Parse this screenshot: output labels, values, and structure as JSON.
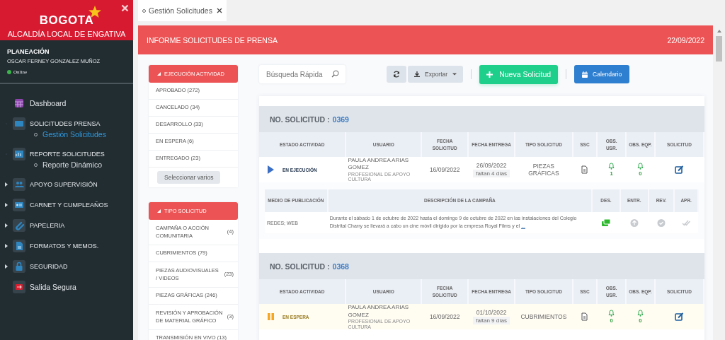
{
  "sidebar": {
    "logo": "BOGOTA",
    "subtitle": "ALCALDÍA LOCAL DE ENGATIVA",
    "user": {
      "role": "PLANEACIÓN",
      "name": "OSCAR FERNEY GONZALEZ MUÑOZ",
      "status": "Online"
    },
    "menu": [
      {
        "kind": "link",
        "label": "Dashboard"
      },
      {
        "kind": "group",
        "label": "SOLICITUDES PRENSA",
        "expanded": true,
        "children": [
          {
            "label": "Gestión Solicitudes",
            "selected": true
          }
        ]
      },
      {
        "kind": "group",
        "label": "REPORTE SOLICITUDES",
        "expanded": true,
        "children": [
          {
            "label": "Reporte Dinámico",
            "selected": false
          }
        ]
      },
      {
        "kind": "group",
        "label": "APOYO SUPERVISIÓN",
        "expanded": false
      },
      {
        "kind": "group",
        "label": "CARNET Y CUMPLEAÑOS",
        "expanded": false
      },
      {
        "kind": "group",
        "label": "PAPELERIA",
        "expanded": false
      },
      {
        "kind": "group",
        "label": "FORMATOS Y MEMOS.",
        "expanded": false
      },
      {
        "kind": "group",
        "label": "SEGURIDAD",
        "expanded": false
      },
      {
        "kind": "link",
        "label": "Salida Segura"
      }
    ]
  },
  "tabs": [
    {
      "label": "Gestión Solicitudes",
      "selected": true
    }
  ],
  "header": {
    "title": "INFORME SOLICITUDES DE PRENSA",
    "date": "22/09/2022"
  },
  "filters": [
    {
      "title": "EJECUCIÓN ACTIVIDAD",
      "items": [
        {
          "label": "APROBADO (272)"
        },
        {
          "label": "CANCELADO (34)"
        },
        {
          "label": "DESARROLLO (33)"
        },
        {
          "label": "EN ESPERA (6)"
        },
        {
          "label": "ENTREGADO (23)"
        }
      ],
      "button": "Seleccionar varios"
    },
    {
      "title": "TIPO SOLICITUD",
      "items": [
        {
          "label": "CAMPAÑA O ACCIÓN COMUNITARIA",
          "count": "(4)"
        },
        {
          "label": "CUBRIMIENTOS (79)"
        },
        {
          "label": "PIEZAS AUDIOVISUALES / VIDEOS",
          "count": "(23)"
        },
        {
          "label": "PIEZAS GRÁFICAS (246)"
        },
        {
          "label": "REVISIÓN Y APROBACIÓN DE MATERIAL GRÁFICO",
          "count": "(3)"
        },
        {
          "label": "TRANSMISIÓN EN VIVO (13)"
        }
      ]
    }
  ],
  "toolbar": {
    "search": {
      "placeholder": "Búsqueda Rápida"
    },
    "export": "Exportar",
    "new": "Nueva Solicitud",
    "calendar": "Calendario"
  },
  "requests": [
    {
      "label": "NO. SOLICITUD :",
      "number": "0369",
      "columns": [
        "ESTADO ACTIVIDAD",
        "USUARIO",
        "FECHA SOLICITUD",
        "FECHA ENTREGA",
        "TIPO SOLICITUD",
        "SSC",
        "OBS. USR.",
        "OBS. EQP.",
        "SOLICITUD"
      ],
      "status": {
        "kind": "running",
        "label": "EN EJECUCIÓN"
      },
      "user": "PAULA ANDREA ARIAS GOMEZ",
      "role": "PROFESIONAL DE APOYO CULTURA",
      "requested": "16/09/2022",
      "due": "26/09/2022",
      "remaining": "faltan 4 días",
      "type": "PIEZAS GRÁFICAS",
      "obs_usr": "1",
      "obs_eqp": "0",
      "detail": {
        "columns": [
          "MEDIO DE PUBLICACIÓN",
          "DESCRIPCIÓN DE LA CAMPAÑA",
          "DES.",
          "ENTR.",
          "REV.",
          "APR."
        ],
        "medium": "REDES; WEB",
        "description": "Durante el sábado 1 de octubre de 2022 hasta el domingo 9 de octubre de 2022 en las instalaciones del Colegio Distrital Charry se llevará a cabo un cine móvil dirigido por la empresa Royal Films y el",
        "more": "...",
        "steps": [
          {
            "done": true
          },
          {
            "done": false
          },
          {
            "done": false
          },
          {
            "done": false
          }
        ]
      }
    },
    {
      "label": "NO. SOLICITUD :",
      "number": "0368",
      "columns": [
        "ESTADO ACTIVIDAD",
        "USUARIO",
        "FECHA SOLICITUD",
        "FECHA ENTREGA",
        "TIPO SOLICITUD",
        "SSC",
        "OBS. USR.",
        "OBS. EQP.",
        "SOLICITUD"
      ],
      "status": {
        "kind": "waiting",
        "label": "EN ESPERA"
      },
      "user": "PAULA ANDREA ARIAS GOMEZ",
      "role": "PROFESIONAL DE APOYO CULTURA",
      "requested": "16/09/2022",
      "due": "01/10/2022",
      "remaining": "faltan 9 días",
      "type": "CUBRIMIENTOS",
      "obs_usr": "0",
      "obs_eqp": "0"
    }
  ]
}
